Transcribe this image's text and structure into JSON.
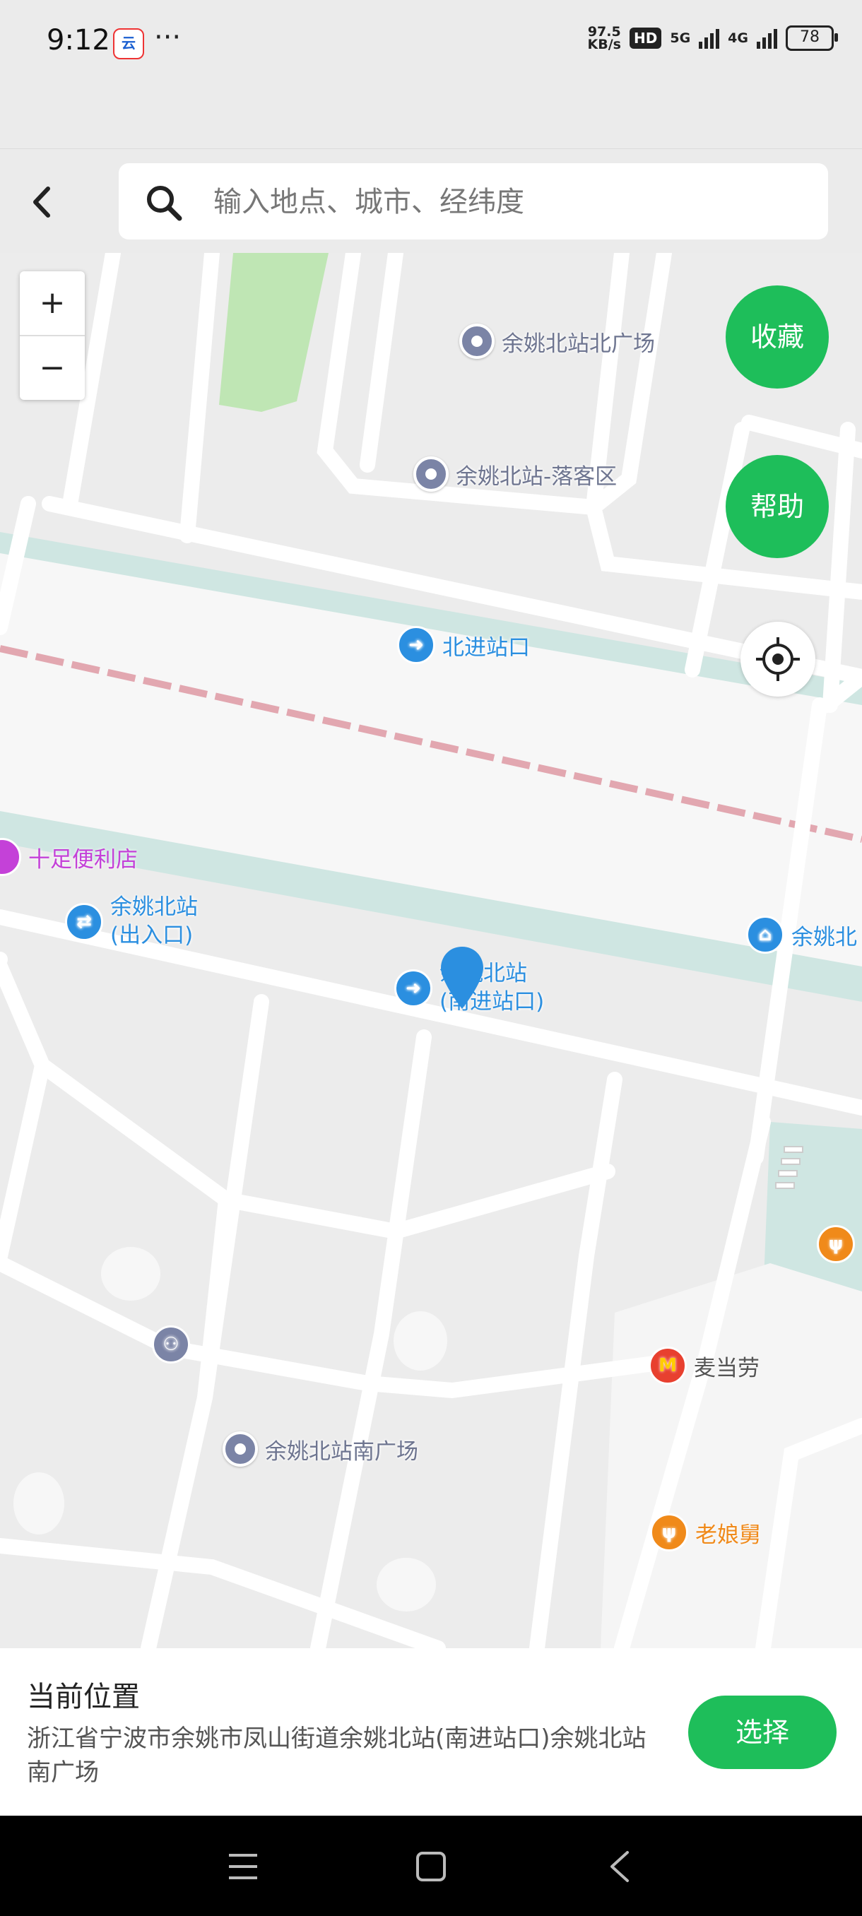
{
  "status_bar": {
    "time": "9:12",
    "app_badge": "云",
    "more": "···",
    "net_speed_value": "97.5",
    "net_speed_unit": "KB/s",
    "hd_label": "HD",
    "net1": "5G",
    "net2": "4G",
    "battery": "78"
  },
  "header": {
    "search_placeholder": "输入地点、城市、经纬度"
  },
  "map": {
    "zoom_in": "+",
    "zoom_out": "−",
    "favorite_button": "收藏",
    "help_button": "帮助",
    "pois": {
      "north_plaza": "余姚北站北广场",
      "drop_off": "余姚北站-落客区",
      "north_entrance": "北进站口",
      "convenience_store": "十足便利店",
      "exit_line1": "余姚北站",
      "exit_line2": "(出入口)",
      "south_entrance_line1": "余姚北站",
      "south_entrance_line2": "(南进站口)",
      "station_cut": "余姚北",
      "mcdonalds": "麦当劳",
      "south_plaza": "余姚北站南广场",
      "restaurant": "老娘舅"
    },
    "colors": {
      "road": "#ffffff",
      "block": "#ececec",
      "station_area": "#f7f7f7",
      "water": "#cfe6e2",
      "green": "#bfe6b4",
      "rail": "#e2a7b0",
      "pin": "#2b8fe0",
      "accent": "#1ebe5a"
    }
  },
  "bottom_panel": {
    "title": "当前位置",
    "address": "浙江省宁波市余姚市凤山街道余姚北站(南进站口)余姚北站南广场",
    "select_button": "选择"
  }
}
